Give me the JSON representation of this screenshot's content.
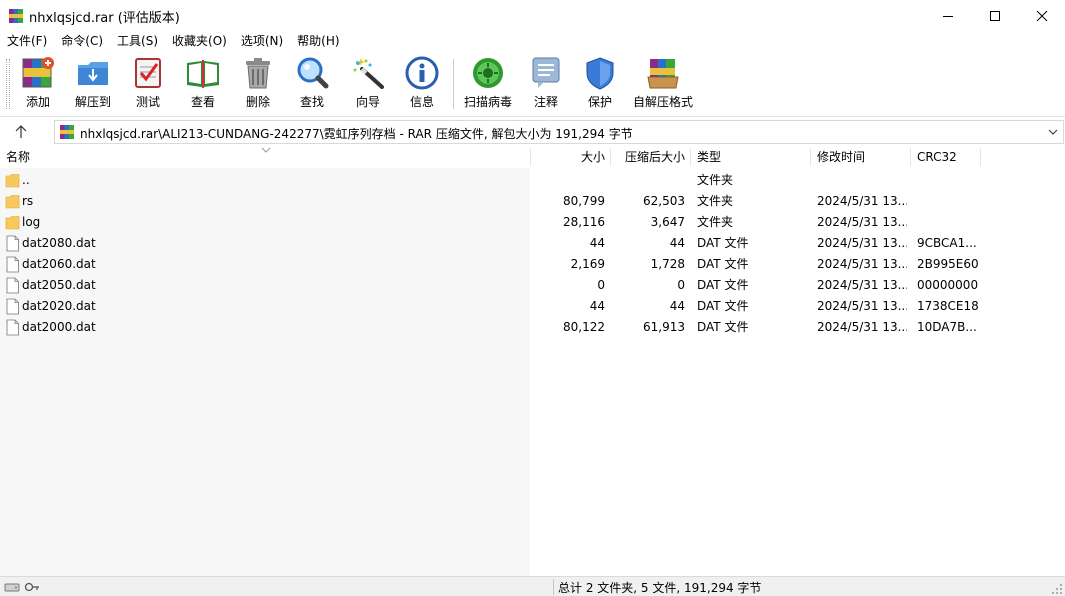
{
  "window": {
    "title": "nhxlqsjcd.rar (评估版本)",
    "controls": [
      "minimize",
      "maximize",
      "close"
    ]
  },
  "menu": [
    "文件(F)",
    "命令(C)",
    "工具(S)",
    "收藏夹(O)",
    "选项(N)",
    "帮助(H)"
  ],
  "toolbar": [
    {
      "label": "添加",
      "icon": "add-archive-icon"
    },
    {
      "label": "解压到",
      "icon": "extract-to-icon"
    },
    {
      "label": "测试",
      "icon": "test-icon"
    },
    {
      "label": "查看",
      "icon": "view-icon"
    },
    {
      "label": "删除",
      "icon": "delete-icon"
    },
    {
      "label": "查找",
      "icon": "find-icon"
    },
    {
      "label": "向导",
      "icon": "wizard-icon"
    },
    {
      "label": "信息",
      "icon": "info-icon"
    },
    {
      "label": "扫描病毒",
      "icon": "virus-scan-icon"
    },
    {
      "label": "注释",
      "icon": "comment-icon"
    },
    {
      "label": "保护",
      "icon": "protect-icon"
    },
    {
      "label": "自解压格式",
      "icon": "sfx-icon"
    }
  ],
  "address": {
    "path": "nhxlqsjcd.rar\\ALI213-CUNDANG-242277\\霓虹序列存档 - RAR 压缩文件, 解包大小为 191,294 字节"
  },
  "columns": {
    "name": "名称",
    "size": "大小",
    "packed": "压缩后大小",
    "type": "类型",
    "modified": "修改时间",
    "crc": "CRC32"
  },
  "files": [
    {
      "name": "..",
      "size": "",
      "packed": "",
      "type": "文件夹",
      "modified": "",
      "crc": "",
      "kind": "folder"
    },
    {
      "name": "rs",
      "size": "80,799",
      "packed": "62,503",
      "type": "文件夹",
      "modified": "2024/5/31 13...",
      "crc": "",
      "kind": "folder"
    },
    {
      "name": "log",
      "size": "28,116",
      "packed": "3,647",
      "type": "文件夹",
      "modified": "2024/5/31 13...",
      "crc": "",
      "kind": "folder"
    },
    {
      "name": "dat2080.dat",
      "size": "44",
      "packed": "44",
      "type": "DAT 文件",
      "modified": "2024/5/31 13...",
      "crc": "9CBCA1...",
      "kind": "file"
    },
    {
      "name": "dat2060.dat",
      "size": "2,169",
      "packed": "1,728",
      "type": "DAT 文件",
      "modified": "2024/5/31 13...",
      "crc": "2B995E60",
      "kind": "file"
    },
    {
      "name": "dat2050.dat",
      "size": "0",
      "packed": "0",
      "type": "DAT 文件",
      "modified": "2024/5/31 13...",
      "crc": "00000000",
      "kind": "file"
    },
    {
      "name": "dat2020.dat",
      "size": "44",
      "packed": "44",
      "type": "DAT 文件",
      "modified": "2024/5/31 13...",
      "crc": "1738CE18",
      "kind": "file"
    },
    {
      "name": "dat2000.dat",
      "size": "80,122",
      "packed": "61,913",
      "type": "DAT 文件",
      "modified": "2024/5/31 13...",
      "crc": "10DA7B...",
      "kind": "file"
    }
  ],
  "status": {
    "summary": "总计 2 文件夹, 5 文件, 191,294 字节"
  },
  "colors": {
    "folder": "#f7c95c",
    "name_column_bg": "#f7f7f7",
    "statusbar": "#f0f0f0"
  }
}
